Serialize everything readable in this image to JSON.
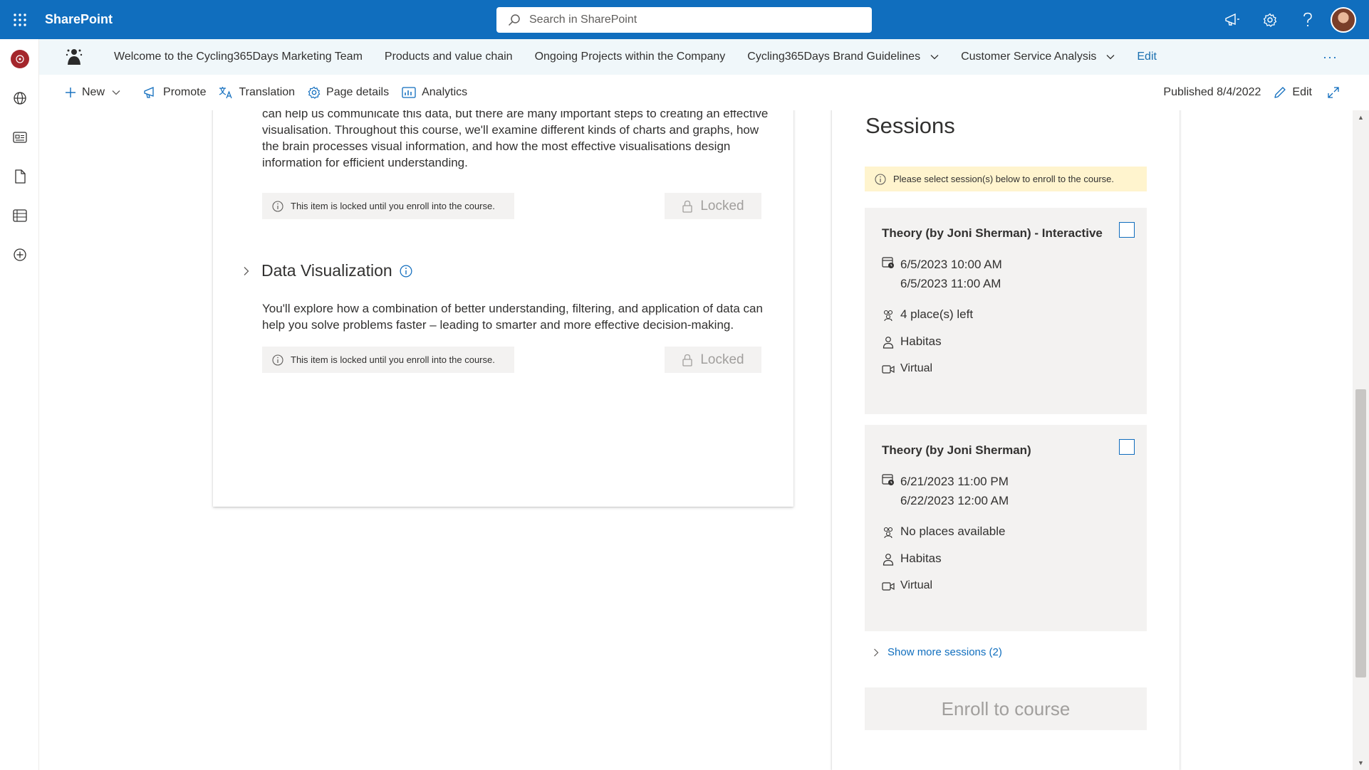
{
  "suite": {
    "app_name": "SharePoint",
    "search_placeholder": "Search in SharePoint"
  },
  "hubnav": {
    "items": [
      {
        "label": "Welcome to the Cycling365Days Marketing Team"
      },
      {
        "label": "Products and value chain"
      },
      {
        "label": "Ongoing Projects within the Company"
      },
      {
        "label": "Cycling365Days Brand Guidelines"
      },
      {
        "label": "Customer Service Analysis"
      }
    ],
    "edit_label": "Edit",
    "more_label": "···"
  },
  "cmdbar": {
    "new_label": "New",
    "promote_label": "Promote",
    "translation_label": "Translation",
    "page_details_label": "Page details",
    "analytics_label": "Analytics",
    "published_label": "Published 8/4/2022",
    "edit_label": "Edit"
  },
  "course": {
    "lesson1_text": "being generated these days, we interpret increasingly larger batches of data. Data visualisation can help us communicate this data, but there are many important steps to creating an effective visualisation. Throughout this course, we'll examine different kinds of charts and graphs, how the brain processes visual information, and how the most effective visualisations design information for efficient understanding.",
    "lesson2_title": "Data Visualization",
    "lesson2_text": "You'll explore how a combination of better understanding, filtering, and application of data can help you solve problems faster – leading to smarter and more effective decision-making.",
    "locked_note": "This item is locked until you enroll into the course.",
    "locked_label": "Locked"
  },
  "sessions": {
    "title": "Sessions",
    "notice": "Please select session(s) below to enroll to the course.",
    "items": [
      {
        "title": "Theory (by Joni Sherman) - Interactive",
        "start": "6/5/2023 10:00 AM",
        "end": "6/5/2023 11:00 AM",
        "places": "4 place(s) left",
        "instructor": "Habitas",
        "location": "Virtual"
      },
      {
        "title": "Theory (by Joni Sherman)",
        "start": "6/21/2023 11:00 PM",
        "end": "6/22/2023 12:00 AM",
        "places": "No places available",
        "instructor": "Habitas",
        "location": "Virtual"
      }
    ],
    "show_more": "Show more sessions (2)",
    "enroll_label": "Enroll to course"
  },
  "colors": {
    "suite_bar": "#106ebe",
    "accent": "#106ebe",
    "notice_bg": "#fff4ce",
    "card_bg": "#f3f2f1"
  }
}
